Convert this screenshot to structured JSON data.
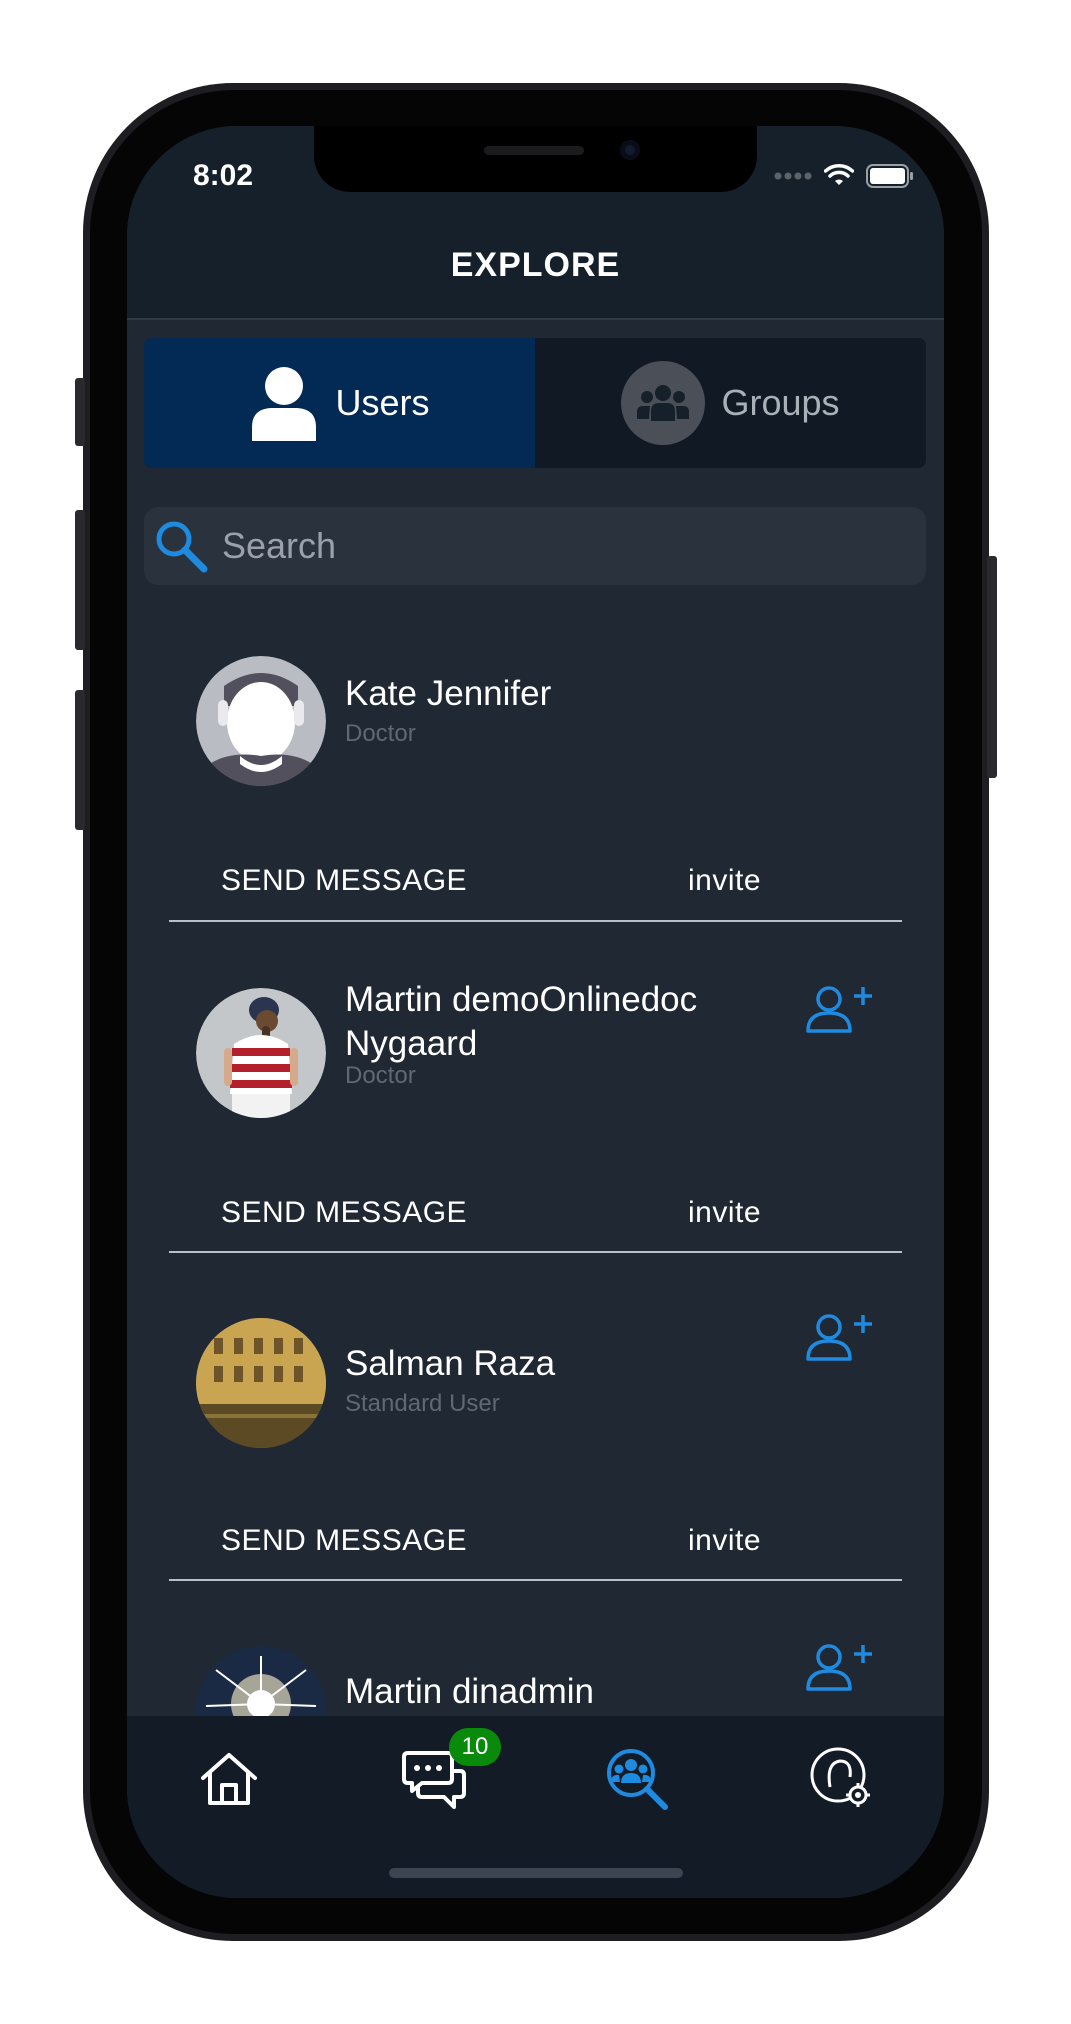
{
  "status_bar": {
    "time": "8:02"
  },
  "header": {
    "title": "EXPLORE"
  },
  "segments": {
    "users": "Users",
    "groups": "Groups"
  },
  "search": {
    "placeholder": "Search",
    "value": ""
  },
  "users": [
    {
      "name": "Kate Jennifer",
      "role": "Doctor",
      "send_message": "SEND MESSAGE",
      "invite": "invite",
      "avatar": "default-avatar",
      "show_add_icon": false
    },
    {
      "name": "Martin demoOnlinedoc Nygaard",
      "role": "Doctor",
      "send_message": "SEND MESSAGE",
      "invite": "invite",
      "avatar": "photo-woman-striped-shirt",
      "show_add_icon": true
    },
    {
      "name": "Salman Raza",
      "role": "Standard User",
      "send_message": "SEND MESSAGE",
      "invite": "invite",
      "avatar": "photo-venice-building",
      "show_add_icon": true
    },
    {
      "name": "Martin dinadmin",
      "role": "",
      "avatar": "photo-fireworks",
      "show_add_icon": true
    }
  ],
  "tab_bar": {
    "items": [
      {
        "icon": "home-icon",
        "active": false
      },
      {
        "icon": "chat-icon",
        "active": false,
        "badge": "10"
      },
      {
        "icon": "explore-icon",
        "active": true
      },
      {
        "icon": "profile-settings-icon",
        "active": false
      }
    ]
  },
  "colors": {
    "background": "#1f2833",
    "header": "#15202b",
    "segment_active": "#032a54",
    "accent": "#1e8ae0",
    "badge": "#0a8a0a"
  }
}
